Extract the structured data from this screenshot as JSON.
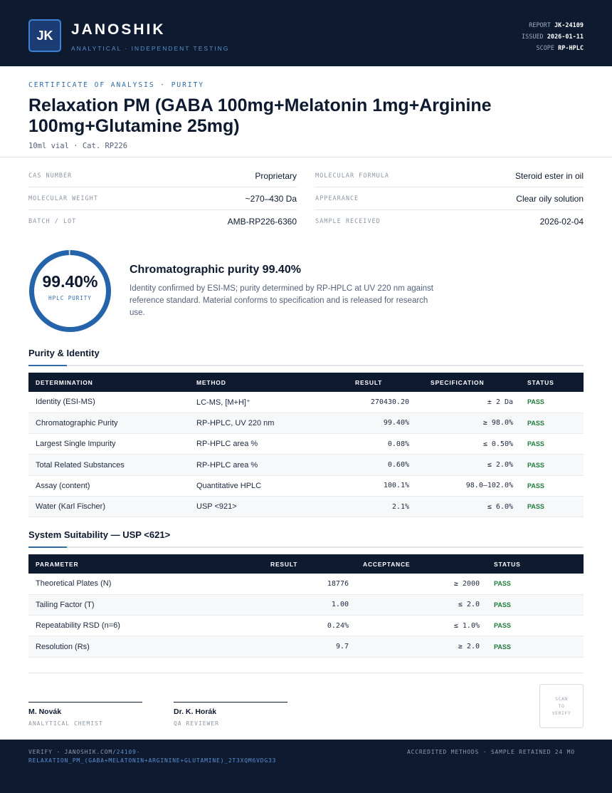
{
  "header": {
    "logo_initials": "JK",
    "brand": "JANOSHIK",
    "tagline": "ANALYTICAL · INDEPENDENT TESTING",
    "report_label": "REPORT",
    "report_value": "JK-24109",
    "issued_label": "ISSUED",
    "issued_value": "2026-01-11",
    "scope_label": "SCOPE",
    "scope_value": "RP-HPLC"
  },
  "document": {
    "eyebrow": "CERTIFICATE OF ANALYSIS · PURITY",
    "title": "Relaxation PM (GABA 100mg+Melatonin 1mg+Arginine 100mg+Glutamine 25mg)",
    "subtitle": "10ml vial · Cat. RP226"
  },
  "info": {
    "left": [
      {
        "label": "CAS NUMBER",
        "value": "Proprietary"
      },
      {
        "label": "MOLECULAR WEIGHT",
        "value": "~270–430 Da"
      },
      {
        "label": "BATCH / LOT",
        "value": "AMB-RP226-6360"
      }
    ],
    "right": [
      {
        "label": "MOLECULAR FORMULA",
        "value": "Steroid ester in oil"
      },
      {
        "label": "APPEARANCE",
        "value": "Clear oily solution"
      },
      {
        "label": "SAMPLE RECEIVED",
        "value": "2026-02-04"
      }
    ]
  },
  "purity": {
    "value": "99.40%",
    "fraction": 0.994,
    "ring_label": "HPLC PURITY",
    "heading": "Chromatographic purity 99.40%",
    "description": "Identity confirmed by ESI-MS; purity determined by RP-HPLC at UV 220 nm against reference standard. Material conforms to specification and is released for research use."
  },
  "purity_table": {
    "heading": "Purity & Identity",
    "columns": [
      "DETERMINATION",
      "METHOD",
      "RESULT",
      "SPECIFICATION",
      "STATUS"
    ],
    "rows": [
      [
        "Identity (ESI-MS)",
        "LC-MS, [M+H]⁺",
        "270430.20",
        "± 2 Da",
        "PASS"
      ],
      [
        "Chromatographic Purity",
        "RP-HPLC, UV 220 nm",
        "99.40%",
        "≥ 98.0%",
        "PASS"
      ],
      [
        "Largest Single Impurity",
        "RP-HPLC area %",
        "0.08%",
        "≤ 0.50%",
        "PASS"
      ],
      [
        "Total Related Substances",
        "RP-HPLC area %",
        "0.60%",
        "≤ 2.0%",
        "PASS"
      ],
      [
        "Assay (content)",
        "Quantitative HPLC",
        "100.1%",
        "98.0–102.0%",
        "PASS"
      ],
      [
        "Water (Karl Fischer)",
        "USP <921>",
        "2.1%",
        "≤ 6.0%",
        "PASS"
      ]
    ]
  },
  "suitability_table": {
    "heading": "System Suitability — USP <621>",
    "columns": [
      "PARAMETER",
      "RESULT",
      "ACCEPTANCE",
      "STATUS"
    ],
    "rows": [
      [
        "Theoretical Plates (N)",
        "18776",
        "≥ 2000",
        "PASS"
      ],
      [
        "Tailing Factor (T)",
        "1.00",
        "≤ 2.0",
        "PASS"
      ],
      [
        "Repeatability RSD (n=6)",
        "0.24%",
        "≤ 1.0%",
        "PASS"
      ],
      [
        "Resolution (Rs)",
        "9.7",
        "≥ 2.0",
        "PASS"
      ]
    ]
  },
  "signatures": [
    {
      "name": "M. Novák",
      "role": "ANALYTICAL CHEMIST"
    },
    {
      "name": "Dr. K. Horák",
      "role": "QA REVIEWER"
    }
  ],
  "qr": {
    "line1": "SCAN",
    "line2": "TO",
    "line3": "VERIFY"
  },
  "footer": {
    "verify_prefix": "VERIFY · JANOSHIK.COM/",
    "verify_link": "24109-RELAXATION_PM_(GABA+MELATONIN+ARGININE+GLUTAMINE)_2T3XQM6VDG33",
    "right_text": "ACCREDITED METHODS · SAMPLE RETAINED 24 MO"
  },
  "colors": {
    "navy": "#0e1a30",
    "accent": "#2d6aa8",
    "ring": "#2563ab",
    "pass": "#1e7b3a"
  }
}
